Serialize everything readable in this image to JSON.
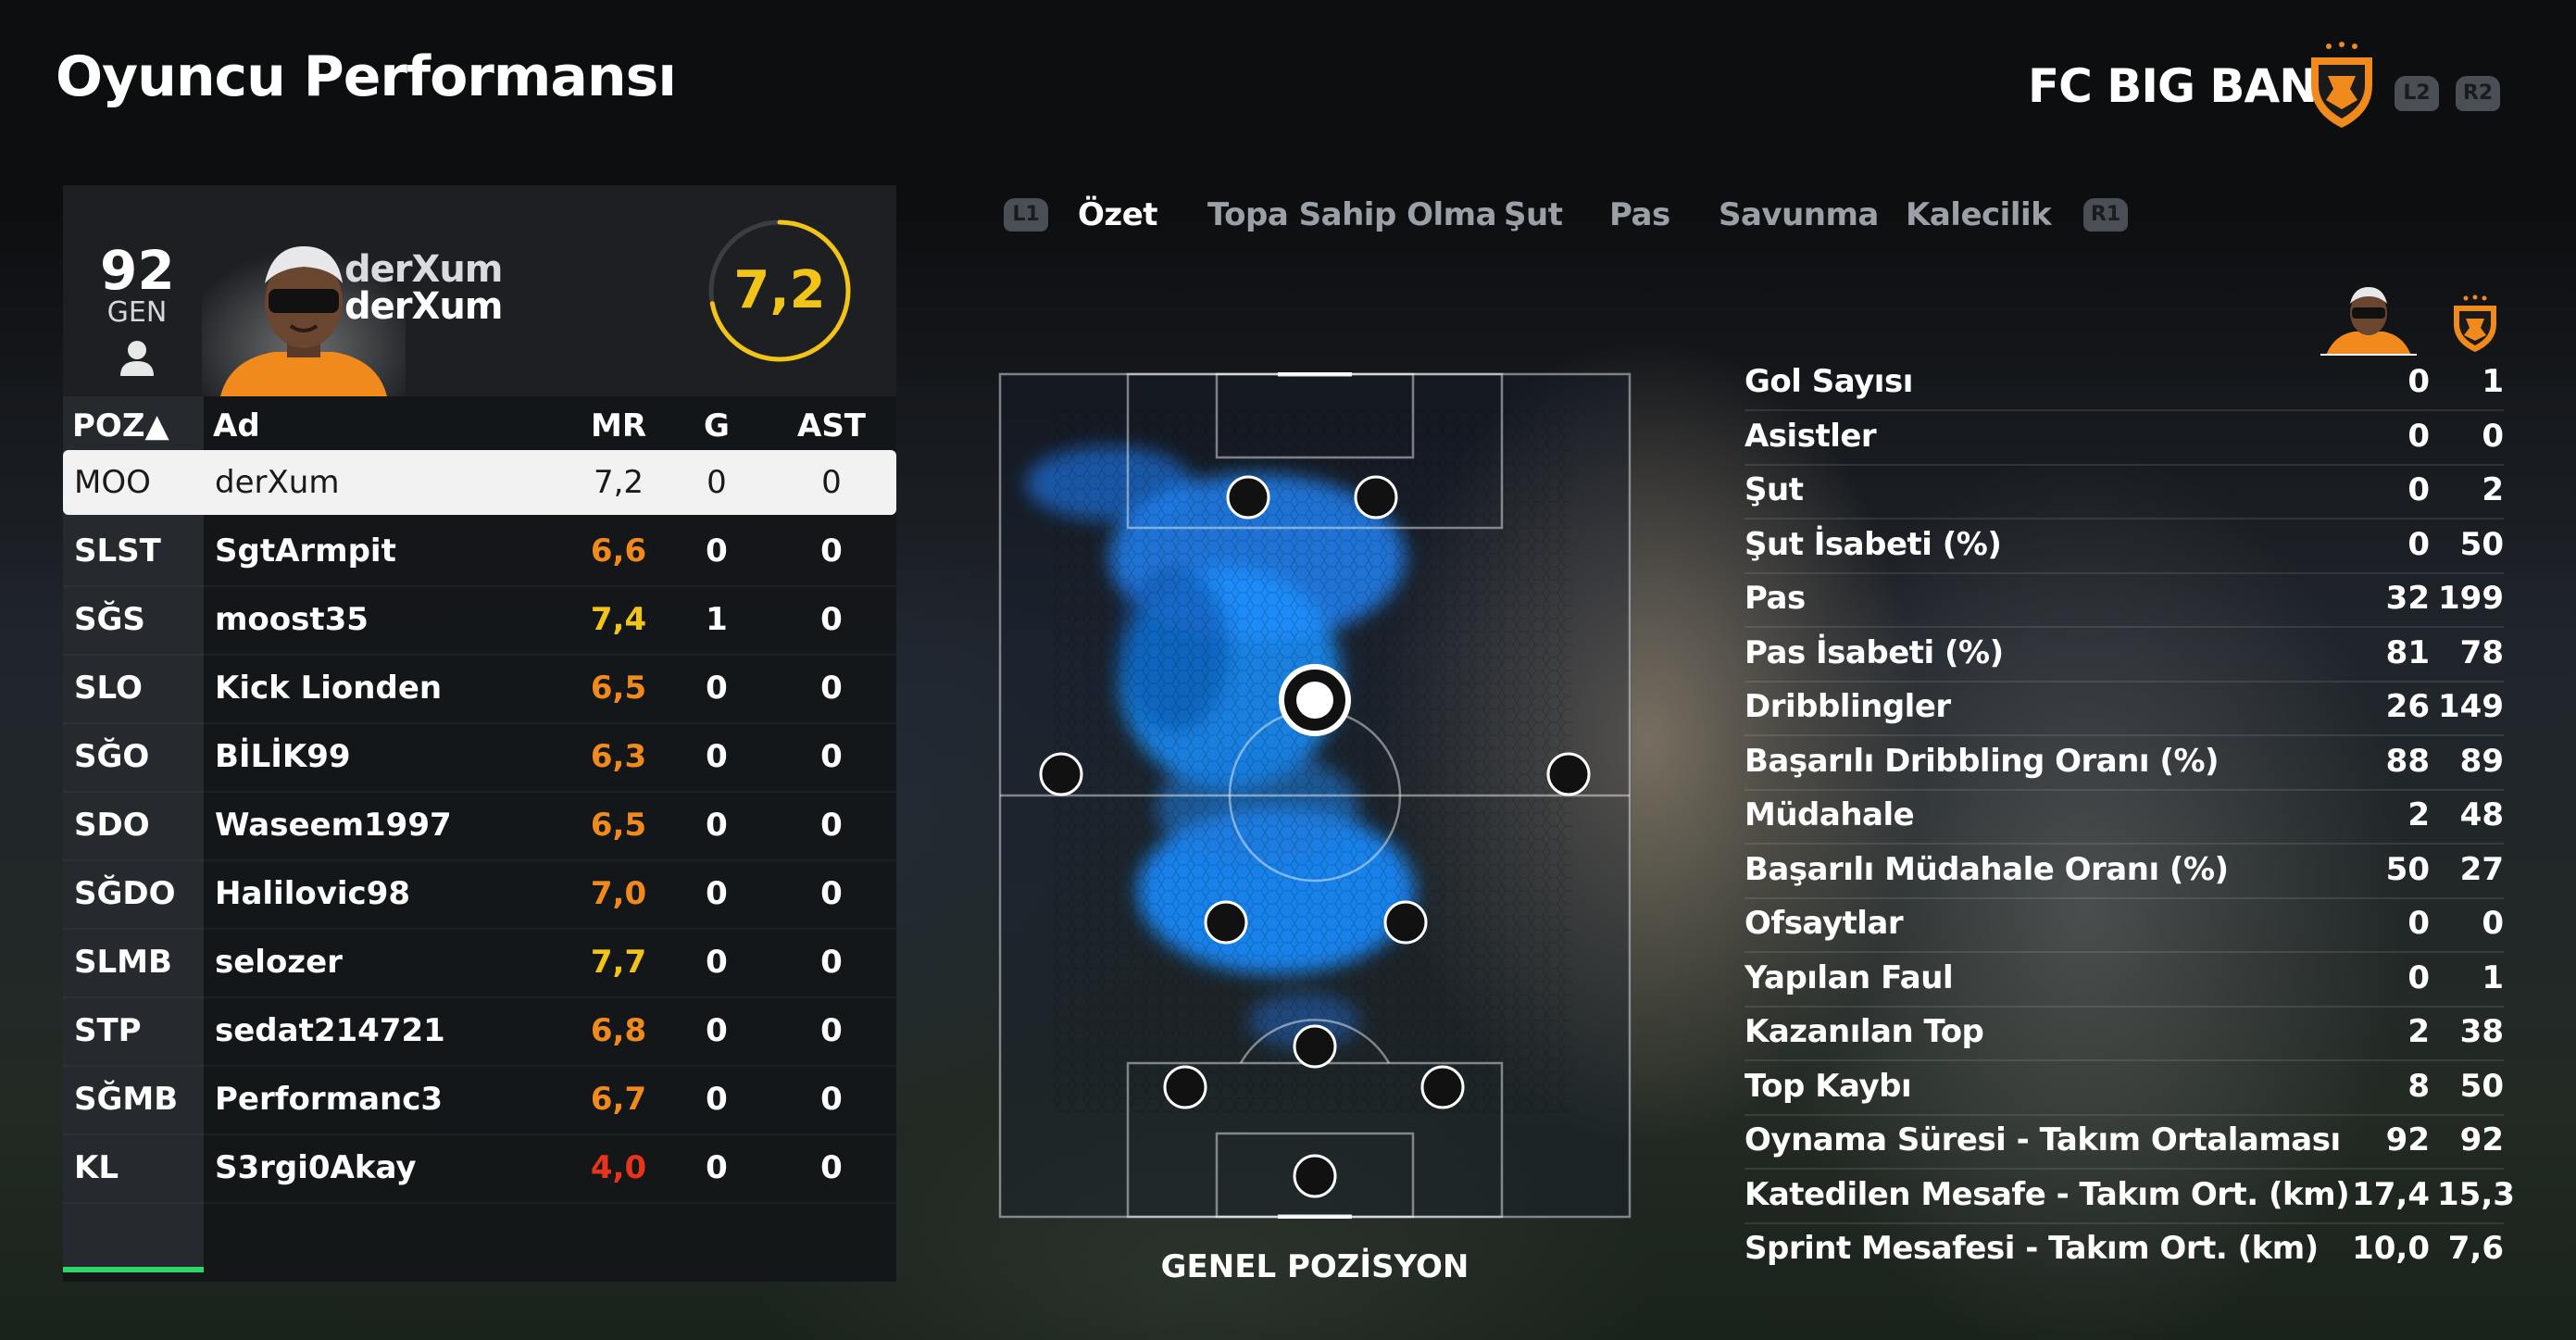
{
  "title": "Oyuncu Performansı",
  "team": {
    "name": "FC BIG BANG",
    "crest_icon": "orange-shield-crest",
    "buttons": {
      "l2": "L2",
      "r2": "R2"
    }
  },
  "player_card": {
    "rating": "92",
    "rating_label": "GEN",
    "name_line1": "derXum",
    "name_line2": "derXum",
    "overall": "7,2",
    "overall_ring_fraction": 0.72
  },
  "table": {
    "headers": {
      "poz": "POZ▲",
      "name": "Ad",
      "mr": "MR",
      "g": "G",
      "ast": "AST"
    },
    "rows": [
      {
        "poz": "MOO",
        "name": "derXum",
        "mr": "7,2",
        "g": "0",
        "ast": "0",
        "selected": true
      },
      {
        "poz": "SLST",
        "name": "SgtArmpit",
        "mr": "6,6",
        "g": "0",
        "ast": "0",
        "mr_color": "#f08a1c"
      },
      {
        "poz": "SĞS",
        "name": "moost35",
        "mr": "7,4",
        "g": "1",
        "ast": "0",
        "mr_color": "#f2c418"
      },
      {
        "poz": "SLO",
        "name": "Kick Lionden",
        "mr": "6,5",
        "g": "0",
        "ast": "0",
        "mr_color": "#f08a1c"
      },
      {
        "poz": "SĞO",
        "name": "BİLİK99",
        "mr": "6,3",
        "g": "0",
        "ast": "0",
        "mr_color": "#f08a1c"
      },
      {
        "poz": "SDO",
        "name": "Waseem1997",
        "mr": "6,5",
        "g": "0",
        "ast": "0",
        "mr_color": "#f08a1c"
      },
      {
        "poz": "SĞDO",
        "name": "Halilovic98",
        "mr": "7,0",
        "g": "0",
        "ast": "0",
        "mr_color": "#f08a1c"
      },
      {
        "poz": "SLMB",
        "name": "selozer",
        "mr": "7,7",
        "g": "0",
        "ast": "0",
        "mr_color": "#f2c418"
      },
      {
        "poz": "STP",
        "name": "sedat214721",
        "mr": "6,8",
        "g": "0",
        "ast": "0",
        "mr_color": "#f08a1c"
      },
      {
        "poz": "SĞMB",
        "name": "Performanc3",
        "mr": "6,7",
        "g": "0",
        "ast": "0",
        "mr_color": "#f08a1c"
      },
      {
        "poz": "KL",
        "name": "S3rgi0Akay",
        "mr": "4,0",
        "g": "0",
        "ast": "0",
        "mr_color": "#e8341c"
      }
    ]
  },
  "tabs": {
    "l1": "L1",
    "r1": "R1",
    "items": [
      "Özet",
      "Topa Sahip Olma",
      "Şut",
      "Pas",
      "Savunma",
      "Kalecilik"
    ],
    "active": 0
  },
  "pitch": {
    "title": "GENEL POZİSYON",
    "heat_color": "#1e90ff"
  },
  "stats": [
    {
      "label": "Gol Sayısı",
      "player": "0",
      "team": "1"
    },
    {
      "label": "Asistler",
      "player": "0",
      "team": "0"
    },
    {
      "label": "Şut",
      "player": "0",
      "team": "2"
    },
    {
      "label": "Şut İsabeti (%)",
      "player": "0",
      "team": "50"
    },
    {
      "label": "Pas",
      "player": "32",
      "team": "199"
    },
    {
      "label": "Pas İsabeti (%)",
      "player": "81",
      "team": "78"
    },
    {
      "label": "Dribblingler",
      "player": "26",
      "team": "149"
    },
    {
      "label": "Başarılı Dribbling Oranı (%)",
      "player": "88",
      "team": "89"
    },
    {
      "label": "Müdahale",
      "player": "2",
      "team": "48"
    },
    {
      "label": "Başarılı Müdahale Oranı (%)",
      "player": "50",
      "team": "27"
    },
    {
      "label": "Ofsaytlar",
      "player": "0",
      "team": "0"
    },
    {
      "label": "Yapılan Faul",
      "player": "0",
      "team": "1"
    },
    {
      "label": "Kazanılan Top",
      "player": "2",
      "team": "38"
    },
    {
      "label": "Top Kaybı",
      "player": "8",
      "team": "50"
    },
    {
      "label": "Oynama Süresi - Takım Ortalaması",
      "player": "92",
      "team": "92"
    },
    {
      "label": "Katedilen Mesafe - Takım Ort. (km)",
      "player": "17,4",
      "team": "15,3"
    },
    {
      "label": "Sprint Mesafesi - Takım Ort. (km)",
      "player": "10,0",
      "team": "7,6"
    }
  ]
}
